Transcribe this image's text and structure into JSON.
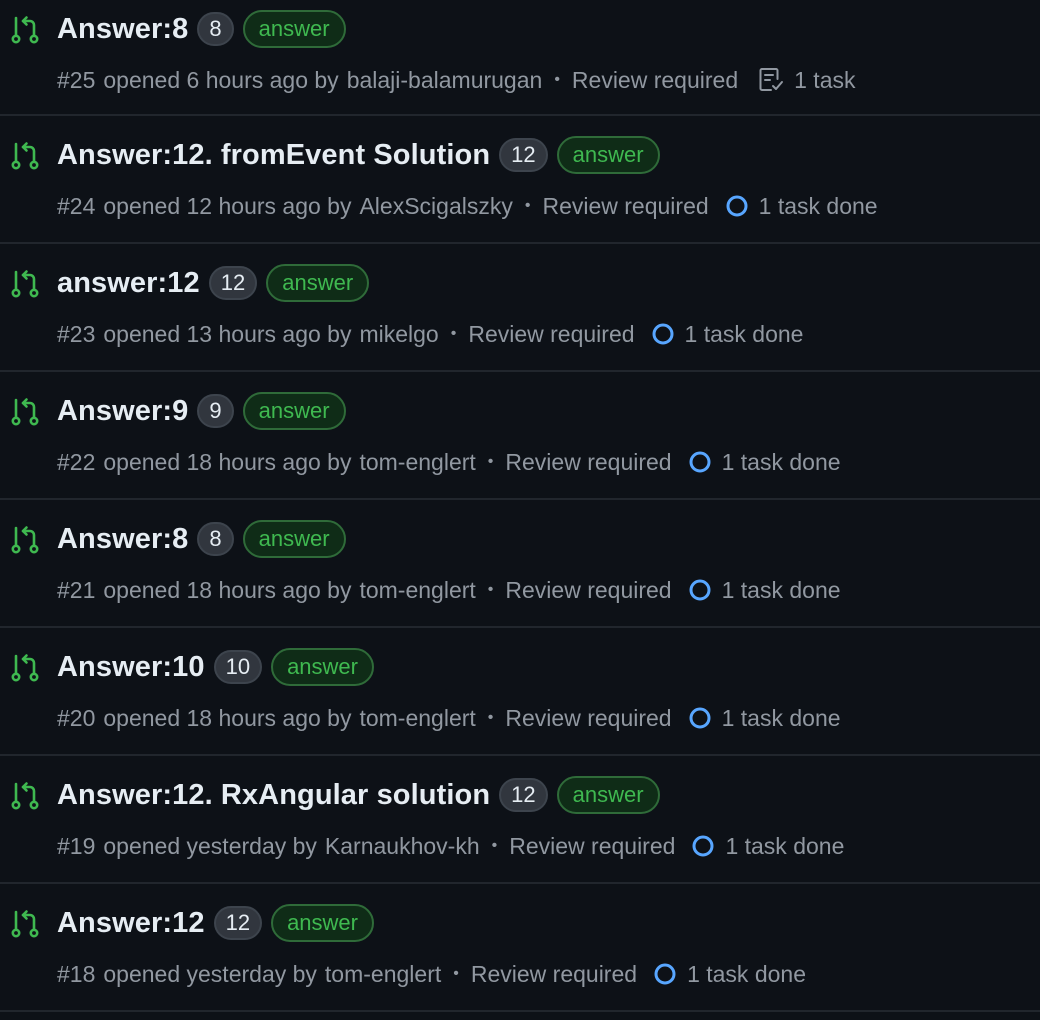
{
  "colors": {
    "background": "#0d1117",
    "open_pr_icon": "#3fb950",
    "label_text": "#3fb950",
    "progress_ring": "#58a6ff"
  },
  "pull_requests": [
    {
      "icon": "git-pull-request-icon",
      "title": "Answer:8",
      "comment_count": "8",
      "label": "answer",
      "number": "#25",
      "opened_text": "opened 6 hours ago by",
      "author": "balaji-balamurugan",
      "review_status": "Review required",
      "task_icon": "checklist-icon",
      "task_text": "1 task"
    },
    {
      "icon": "git-pull-request-icon",
      "title": "Answer:12. fromEvent Solution",
      "comment_count": "12",
      "label": "answer",
      "number": "#24",
      "opened_text": "opened 12 hours ago by",
      "author": "AlexScigalszky",
      "review_status": "Review required",
      "task_icon": "progress-ring-icon",
      "task_text": "1 task done"
    },
    {
      "icon": "git-pull-request-icon",
      "title": "answer:12",
      "comment_count": "12",
      "label": "answer",
      "number": "#23",
      "opened_text": "opened 13 hours ago by",
      "author": "mikelgo",
      "review_status": "Review required",
      "task_icon": "progress-ring-icon",
      "task_text": "1 task done"
    },
    {
      "icon": "git-pull-request-icon",
      "title": "Answer:9",
      "comment_count": "9",
      "label": "answer",
      "number": "#22",
      "opened_text": "opened 18 hours ago by",
      "author": "tom-englert",
      "review_status": "Review required",
      "task_icon": "progress-ring-icon",
      "task_text": "1 task done"
    },
    {
      "icon": "git-pull-request-icon",
      "title": "Answer:8",
      "comment_count": "8",
      "label": "answer",
      "number": "#21",
      "opened_text": "opened 18 hours ago by",
      "author": "tom-englert",
      "review_status": "Review required",
      "task_icon": "progress-ring-icon",
      "task_text": "1 task done"
    },
    {
      "icon": "git-pull-request-icon",
      "title": "Answer:10",
      "comment_count": "10",
      "label": "answer",
      "number": "#20",
      "opened_text": "opened 18 hours ago by",
      "author": "tom-englert",
      "review_status": "Review required",
      "task_icon": "progress-ring-icon",
      "task_text": "1 task done"
    },
    {
      "icon": "git-pull-request-icon",
      "title": "Answer:12. RxAngular solution",
      "comment_count": "12",
      "label": "answer",
      "number": "#19",
      "opened_text": "opened yesterday by",
      "author": "Karnaukhov-kh",
      "review_status": "Review required",
      "task_icon": "progress-ring-icon",
      "task_text": "1 task done"
    },
    {
      "icon": "git-pull-request-icon",
      "title": "Answer:12",
      "comment_count": "12",
      "label": "answer",
      "number": "#18",
      "opened_text": "opened yesterday by",
      "author": "tom-englert",
      "review_status": "Review required",
      "task_icon": "progress-ring-icon",
      "task_text": "1 task done"
    }
  ]
}
